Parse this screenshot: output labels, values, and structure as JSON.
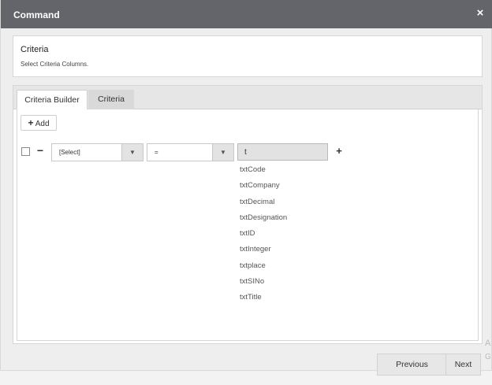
{
  "window": {
    "title": "Command",
    "close_label": "×"
  },
  "criteria": {
    "heading": "Criteria",
    "subtext": "Select Criteria Columns."
  },
  "tabs": [
    {
      "label": "Criteria Builder",
      "active": true
    },
    {
      "label": "Criteria",
      "active": false
    }
  ],
  "builder": {
    "add_label": "Add",
    "add_icon": "+",
    "rule": {
      "remove_icon": "−",
      "field_value": "[Select]",
      "operator_value": "=",
      "input_value": "t",
      "add_icon": "+"
    },
    "suggestions": [
      "txtCode",
      "txtCompany",
      "txtDecimal",
      "txtDesignation",
      "txtID",
      "txtInteger",
      "txtplace",
      "txtSINo",
      "txtTitle"
    ]
  },
  "watermark": [
    "A",
    "G"
  ],
  "footer": {
    "previous_label": "Previous",
    "next_label": "Next"
  },
  "colors": {
    "titlebar": "#63656a",
    "input_bg": "#e2e2e2"
  },
  "icons": {
    "close": "close-icon",
    "add": "plus-icon",
    "remove": "minus-icon",
    "dropdown": "chevron-down-icon"
  }
}
